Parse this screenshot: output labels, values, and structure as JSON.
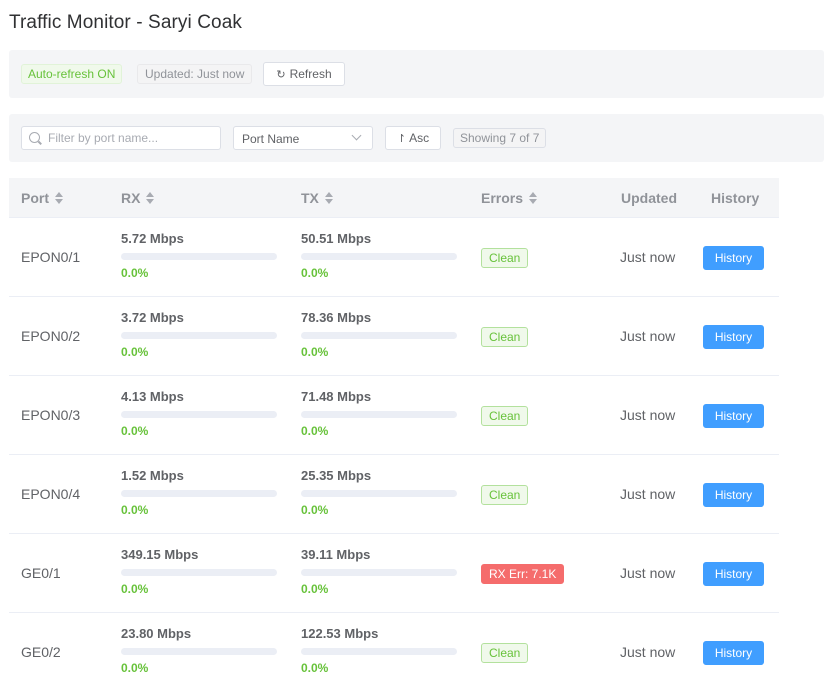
{
  "app": {
    "title": "Traffic Monitor - Saryi Coak"
  },
  "toolbar": {
    "auto_refresh": "Auto-refresh ON",
    "updated": "Updated: Just now",
    "refresh_label": "Refresh",
    "refresh_icon": "refresh-icon"
  },
  "filters": {
    "search_placeholder": "Filter by port name...",
    "sort_field": "Port Name",
    "sort_dir_label": "Asc",
    "sort_dir_icon": "sort-asc-icon",
    "showing": "Showing 7 of 7"
  },
  "table": {
    "headers": {
      "port": "Port",
      "rx": "RX",
      "tx": "TX",
      "errors": "Errors",
      "updated": "Updated",
      "history": "History"
    },
    "rows": [
      {
        "port": "EPON0/1",
        "rx": {
          "rate": "5.72 Mbps",
          "pct": "0.0%",
          "level": 0
        },
        "tx": {
          "rate": "50.51 Mbps",
          "pct": "0.0%",
          "level": 0
        },
        "errors": "Clean",
        "error_state": "clean",
        "updated": "Just now",
        "action": "History"
      },
      {
        "port": "EPON0/2",
        "rx": {
          "rate": "3.72 Mbps",
          "pct": "0.0%",
          "level": 0
        },
        "tx": {
          "rate": "78.36 Mbps",
          "pct": "0.0%",
          "level": 0
        },
        "errors": "Clean",
        "error_state": "clean",
        "updated": "Just now",
        "action": "History"
      },
      {
        "port": "EPON0/3",
        "rx": {
          "rate": "4.13 Mbps",
          "pct": "0.0%",
          "level": 0
        },
        "tx": {
          "rate": "71.48 Mbps",
          "pct": "0.0%",
          "level": 0
        },
        "errors": "Clean",
        "error_state": "clean",
        "updated": "Just now",
        "action": "History"
      },
      {
        "port": "EPON0/4",
        "rx": {
          "rate": "1.52 Mbps",
          "pct": "0.0%",
          "level": 0
        },
        "tx": {
          "rate": "25.35 Mbps",
          "pct": "0.0%",
          "level": 0
        },
        "errors": "Clean",
        "error_state": "clean",
        "updated": "Just now",
        "action": "History"
      },
      {
        "port": "GE0/1",
        "rx": {
          "rate": "349.15 Mbps",
          "pct": "0.0%",
          "level": 0
        },
        "tx": {
          "rate": "39.11 Mbps",
          "pct": "0.0%",
          "level": 0
        },
        "errors": "RX Err: 7.1K",
        "error_state": "error",
        "updated": "Just now",
        "action": "History"
      },
      {
        "port": "GE0/2",
        "rx": {
          "rate": "23.80 Mbps",
          "pct": "0.0%",
          "level": 0
        },
        "tx": {
          "rate": "122.53 Mbps",
          "pct": "0.0%",
          "level": 0
        },
        "errors": "Clean",
        "error_state": "clean",
        "updated": "Just now",
        "action": "History"
      }
    ]
  },
  "colors": {
    "primary": "#409eff",
    "success": "#67c23a",
    "danger": "#f56c6c"
  }
}
